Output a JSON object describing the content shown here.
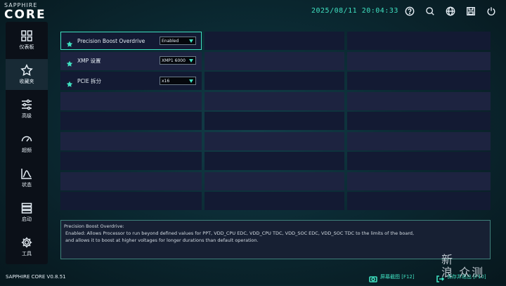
{
  "app": {
    "logo_top": "SAPPHIRE",
    "logo_main": "CORE",
    "datetime": "2025/08/11 20:04:33",
    "version": "SAPPHIRE CORE V0.8.51"
  },
  "header": {
    "icons": [
      "help-icon",
      "search-icon",
      "globe-icon",
      "save-icon",
      "power-icon"
    ]
  },
  "sidebar": {
    "items": [
      {
        "label": "仪表板",
        "icon": "dashboard-icon"
      },
      {
        "label": "收藏夹",
        "icon": "star-icon"
      },
      {
        "label": "高级",
        "icon": "sliders-icon"
      },
      {
        "label": "超频",
        "icon": "gauge-icon"
      },
      {
        "label": "状态",
        "icon": "chart-icon"
      },
      {
        "label": "启动",
        "icon": "boot-icon"
      },
      {
        "label": "工具",
        "icon": "gear-icon"
      }
    ],
    "active_index": 1
  },
  "settings": [
    {
      "name": "Precision Boost Overdrive",
      "value": "Enabled"
    },
    {
      "name": "XMP 设置",
      "value": "XMP1 6000"
    },
    {
      "name": "PCIE 拆分",
      "value": "x16"
    }
  ],
  "description": {
    "title": "Precision Boost Overdrive:",
    "body": "Enabled: Allows Processor to run beyond defined values for PPT, VDD_CPU EDC, VDD_CPU TDC, VDD_SOC EDC, VDD_SOC TDC to the limits of the board,\nand allows it to boost at higher voltages for longer durations than default operation."
  },
  "footer": {
    "screenshot_label": "屏幕截图 [F12]",
    "exit_label": "保存并退出 [F10]"
  },
  "watermark": {
    "line1": "新",
    "line2": "浪 众测"
  },
  "colors": {
    "accent": "#3fe0c0"
  }
}
